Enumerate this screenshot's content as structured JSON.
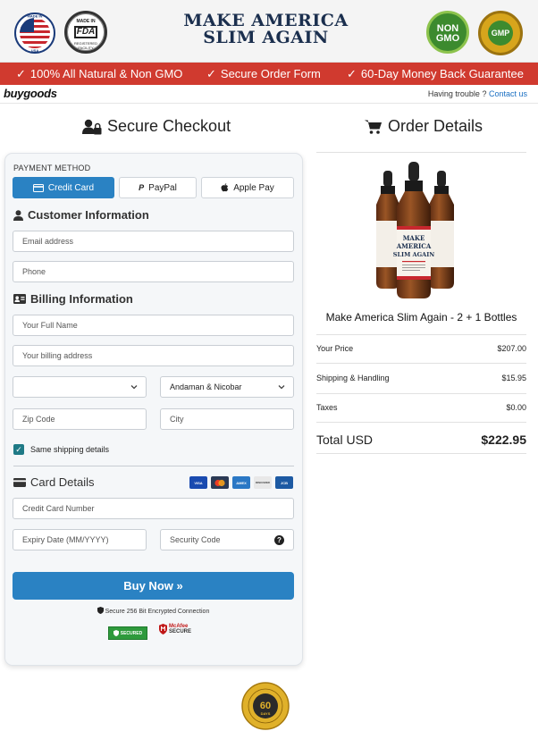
{
  "header": {
    "usa_badge": {
      "top": "MADE IN",
      "bottom": "USA"
    },
    "fda_badge": {
      "top": "MADE IN",
      "mark": "FDA",
      "bottom": "REGISTERED FACILITY"
    },
    "brand_line1": "MAKE AMERICA",
    "brand_line2": "SLIM AGAIN",
    "nongmo_badge": {
      "line1": "NON",
      "line2": "GMO"
    },
    "gmp_badge": {
      "mark": "GMP",
      "ring": "GOOD MANUFACTURING PRACTICE"
    }
  },
  "banner": {
    "items": [
      "100% All Natural & Non GMO",
      "Secure Order Form",
      "60-Day Money Back Guarantee"
    ],
    "color": "#d03a2f"
  },
  "topbar": {
    "logo": "buygoods",
    "trouble_text": "Having trouble ?",
    "contact_link": "Contact us"
  },
  "checkout": {
    "title": "Secure Checkout",
    "payment_method_label": "PAYMENT METHOD",
    "payment_methods": [
      "Credit Card",
      "PayPal",
      "Apple Pay"
    ],
    "customer_info_title": "Customer Information",
    "email_placeholder": "Email address",
    "phone_placeholder": "Phone",
    "billing_info_title": "Billing Information",
    "fullname_placeholder": "Your Full Name",
    "address_placeholder": "Your billing address",
    "country_value": "",
    "state_value": "Andaman & Nicobar",
    "zip_placeholder": "Zip Code",
    "city_placeholder": "City",
    "same_shipping_label": "Same shipping details",
    "card_details_title": "Card Details",
    "card_brands": [
      "VISA",
      "MC",
      "AMEX",
      "DISCOVER",
      "JCB"
    ],
    "card_number_placeholder": "Credit Card Number",
    "expiry_placeholder": "Expiry Date (MM/YYYY)",
    "cvv_placeholder": "Security Code",
    "buy_button": "Buy Now »",
    "secure_connection": "Secure 256 Bit Encrypted Connection",
    "seal_secured": "SECURED",
    "seal_mcafee_line1": "McAfee",
    "seal_mcafee_line2": "SECURE",
    "accent": "#2a82c3"
  },
  "order": {
    "title": "Order Details",
    "product_name": "Make America Slim Again - 2 + 1 Bottles",
    "bottle_label_line1": "MAKE",
    "bottle_label_line2": "AMERICA",
    "bottle_label_line3": "SLIM AGAIN",
    "rows": [
      {
        "label": "Your Price",
        "value": "$207.00"
      },
      {
        "label": "Shipping & Handling",
        "value": "$15.95"
      },
      {
        "label": "Taxes",
        "value": "$0.00"
      }
    ],
    "total_label": "Total USD",
    "total_value": "$222.95"
  },
  "guarantee": {
    "days": "60",
    "sub": "DAYS",
    "ring": "100% MONEY BACK GUARANTEE"
  }
}
